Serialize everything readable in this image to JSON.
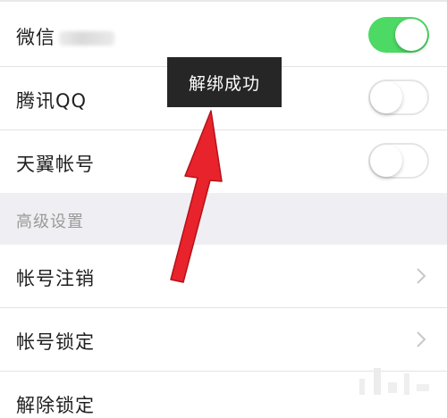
{
  "accounts": {
    "wechat": {
      "label": "微信",
      "enabled": true
    },
    "qq": {
      "label": "腾讯QQ",
      "enabled": false
    },
    "tianyi": {
      "label": "天翼帐号",
      "enabled": false
    }
  },
  "section": {
    "advanced_label": "高级设置"
  },
  "advanced": {
    "items": [
      {
        "label": "帐号注销"
      },
      {
        "label": "帐号锁定"
      },
      {
        "label": "解除锁定"
      }
    ]
  },
  "toast": {
    "message": "解绑成功"
  },
  "colors": {
    "toggle_on": "#4cd964",
    "section_bg": "#efeff3",
    "toast_bg": "#262626",
    "arrow": "#e8232b"
  }
}
